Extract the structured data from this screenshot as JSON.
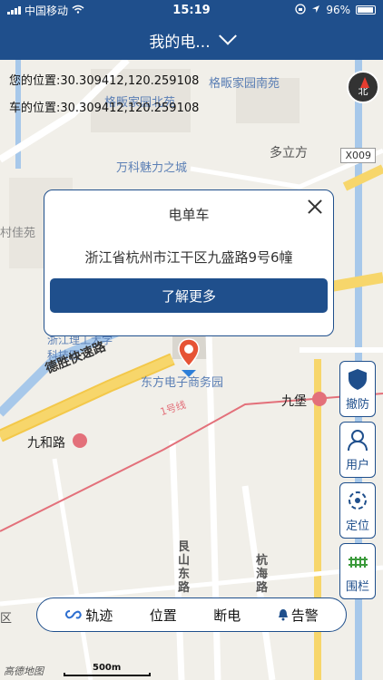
{
  "status_bar": {
    "carrier": "中国移动",
    "time": "15:19",
    "battery": "96%"
  },
  "nav": {
    "title": "我的电...",
    "chevron_icon": "chevron-down-icon"
  },
  "location": {
    "my_position": "您的位置:30.309412,120.259108",
    "car_position": "车的位置:30.309412,120.259108"
  },
  "map": {
    "compass_label": "北",
    "road_badge": "X009",
    "pois": [
      "格畈家园南苑",
      "格畈家园北苑",
      "万科魅力之城",
      "多立方",
      "村佳苑",
      "浙江理工大学科技园",
      "东方电子商务园",
      "九堡",
      "九和路",
      "德胜快速路",
      "1号线",
      "艮山东路",
      "杭海路",
      "区"
    ]
  },
  "popup": {
    "title": "电单车",
    "address": "浙江省杭州市江干区九盛路9号6幢",
    "more_button": "了解更多"
  },
  "side_buttons": {
    "disarm": "撤防",
    "user": "用户",
    "locate": "定位",
    "fence": "围栏"
  },
  "toolbar": {
    "track": "轨迹",
    "position": "位置",
    "power_off": "断电",
    "alarm": "告警"
  },
  "footer": {
    "map_logo": "高德地图",
    "scale": "500m"
  },
  "colors": {
    "primary": "#1f4f8c",
    "road_yellow": "#f7d66b",
    "river": "#a7c8ea"
  }
}
